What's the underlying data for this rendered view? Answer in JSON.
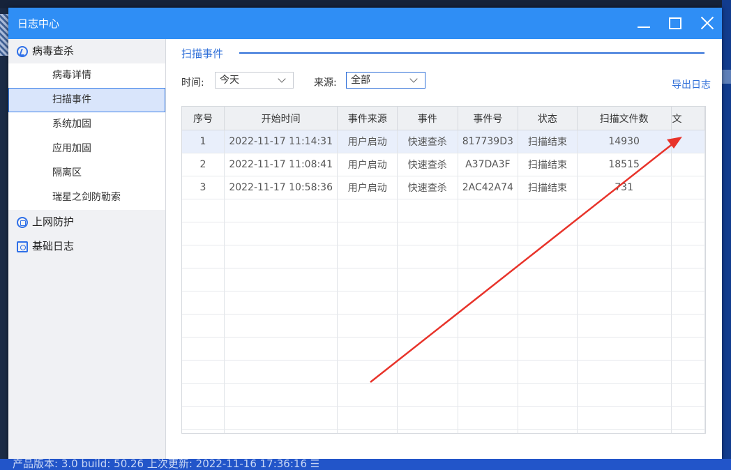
{
  "window": {
    "title": "日志中心"
  },
  "sidebar": {
    "groups": [
      {
        "label": "病毒查杀",
        "icon": "virus-scan-icon",
        "items": [
          "病毒详情",
          "扫描事件",
          "系统加固",
          "应用加固",
          "隔离区",
          "瑞星之剑防勒索"
        ],
        "active_item": "扫描事件"
      },
      {
        "label": "上网防护",
        "icon": "web-protection-icon",
        "items": []
      },
      {
        "label": "基础日志",
        "icon": "basic-log-icon",
        "items": []
      }
    ]
  },
  "main": {
    "section_title": "扫描事件",
    "filters": {
      "time_label": "时间:",
      "time_value": "今天",
      "source_label": "来源:",
      "source_value": "全部"
    },
    "export_label": "导出日志",
    "table": {
      "columns": [
        "序号",
        "开始时间",
        "事件来源",
        "事件",
        "事件号",
        "状态",
        "扫描文件数",
        "文"
      ],
      "rows": [
        [
          "1",
          "2022-11-17 11:14:31",
          "用户启动",
          "快速查杀",
          "817739D3",
          "扫描结束",
          "14930",
          ""
        ],
        [
          "2",
          "2022-11-17 11:08:41",
          "用户启动",
          "快速查杀",
          "A37DA3F",
          "扫描结束",
          "18515",
          ""
        ],
        [
          "3",
          "2022-11-17 10:58:36",
          "用户启动",
          "快速查杀",
          "2AC42A74",
          "扫描结束",
          "731",
          ""
        ]
      ],
      "selected_row": 0,
      "empty_rows": 11
    }
  },
  "footer": {
    "text": "产品版本: 3.0  build: 50.26   上次更新: 2022-11-16 17:36:16  ☰"
  },
  "colors": {
    "titlebar": "#2f8ef5",
    "accent": "#2f6fd8",
    "annotation": "#e8332a"
  }
}
